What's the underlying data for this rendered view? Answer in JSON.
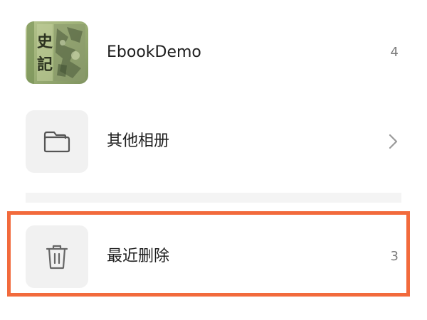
{
  "albums": [
    {
      "label": "EbookDemo",
      "count": "4",
      "cover_text_top": "史",
      "cover_text_bottom": "記"
    },
    {
      "label": "其他相册"
    },
    {
      "label": "最近删除",
      "count": "3"
    }
  ],
  "colors": {
    "highlight": "#f26a3c",
    "icon_tile": "#f1f1f1",
    "divider": "#f4f4f4",
    "cover_green": "#9fb07a"
  },
  "icons": {
    "folder": "folder-icon",
    "trash": "trash-icon",
    "chevron": "chevron-right-icon"
  }
}
